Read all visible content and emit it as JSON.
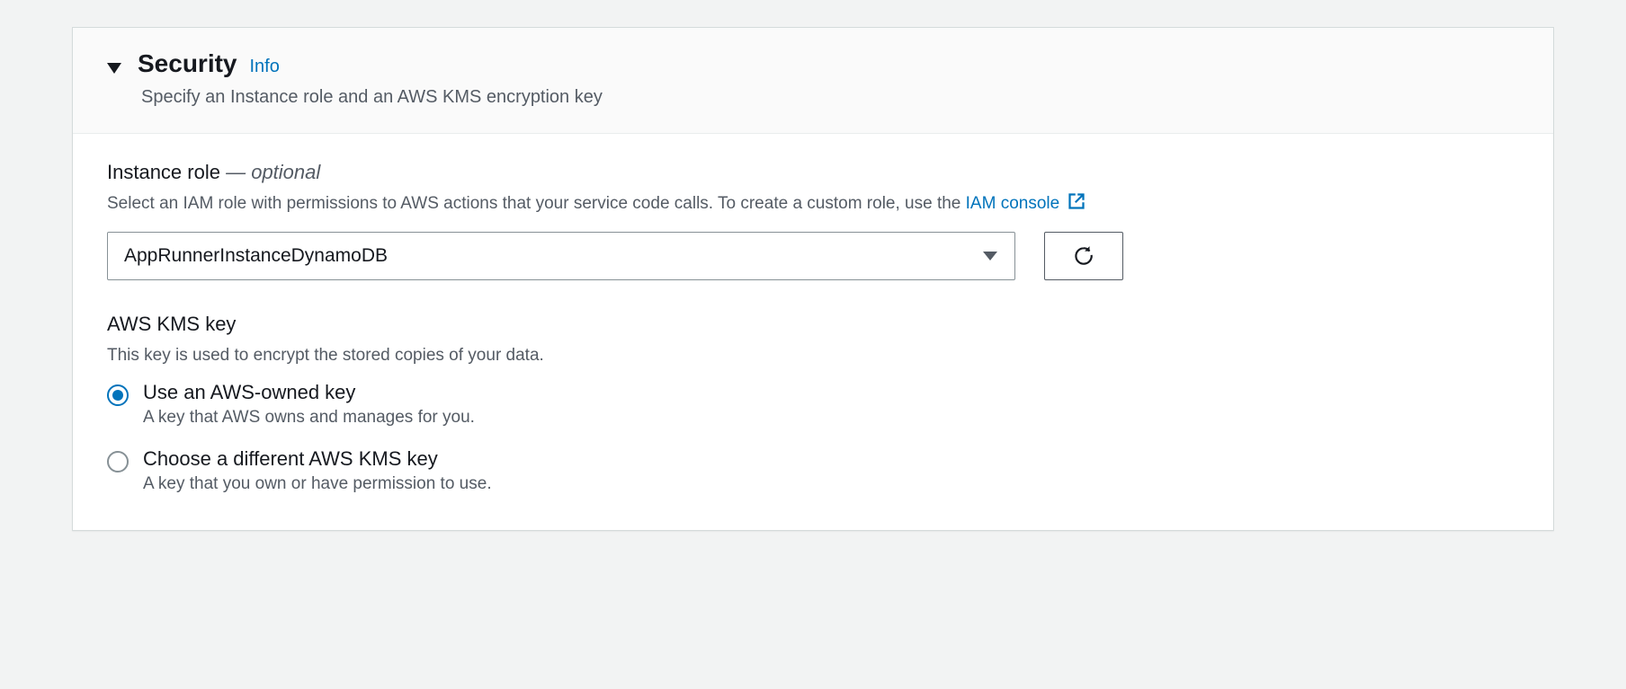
{
  "panel": {
    "title": "Security",
    "info": "Info",
    "subtitle": "Specify an Instance role and an AWS KMS encryption key"
  },
  "instanceRole": {
    "label": "Instance role",
    "optional": "— optional",
    "helpPrefix": "Select an IAM role with permissions to AWS actions that your service code calls. To create a custom role, use the ",
    "helpLinkText": "IAM console",
    "selectedValue": "AppRunnerInstanceDynamoDB"
  },
  "kms": {
    "label": "AWS KMS key",
    "help": "This key is used to encrypt the stored copies of your data.",
    "options": [
      {
        "title": "Use an AWS-owned key",
        "desc": "A key that AWS owns and manages for you.",
        "selected": true
      },
      {
        "title": "Choose a different AWS KMS key",
        "desc": "A key that you own or have permission to use.",
        "selected": false
      }
    ]
  }
}
